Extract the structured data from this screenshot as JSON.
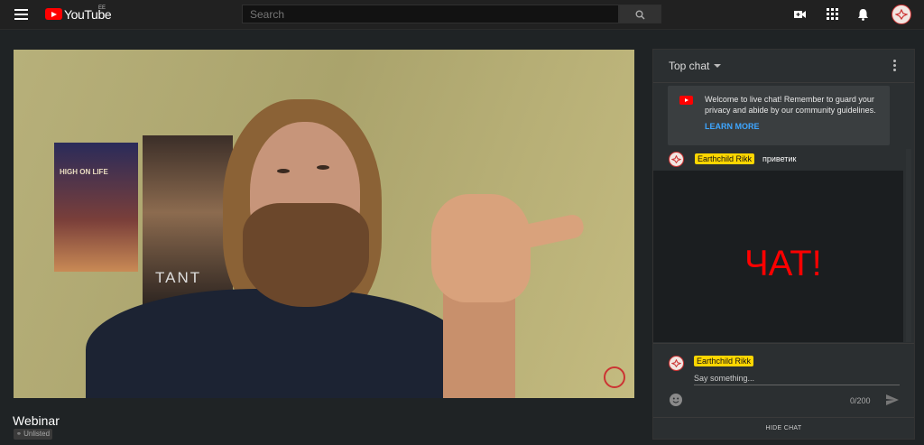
{
  "header": {
    "logo_text": "YouTube",
    "country_code": "EE",
    "search_placeholder": "Search",
    "icons": [
      "menu-icon",
      "search-icon",
      "create-video-icon",
      "apps-icon",
      "notifications-icon",
      "avatar"
    ]
  },
  "video": {
    "title": "Webinar",
    "visibility": "Unlisted",
    "poster1_text": "HIGH ON LIFE",
    "poster2_text": "TANT"
  },
  "chat": {
    "mode_label": "Top chat",
    "notice_text": "Welcome to live chat! Remember to guard your privacy and abide by our community guidelines.",
    "learn_more": "LEARN MORE",
    "messages": [
      {
        "author": "Earthchild Rikk",
        "text": "приветик"
      }
    ],
    "overlay_text": "ЧАТ!",
    "compose": {
      "author": "Earthchild Rikk",
      "placeholder": "Say something...",
      "counter": "0/200"
    },
    "hide_chat": "HIDE CHAT"
  },
  "colors": {
    "brand_red": "#ff0000",
    "badge_yellow": "#ffd600",
    "link_blue": "#3ea6ff"
  }
}
